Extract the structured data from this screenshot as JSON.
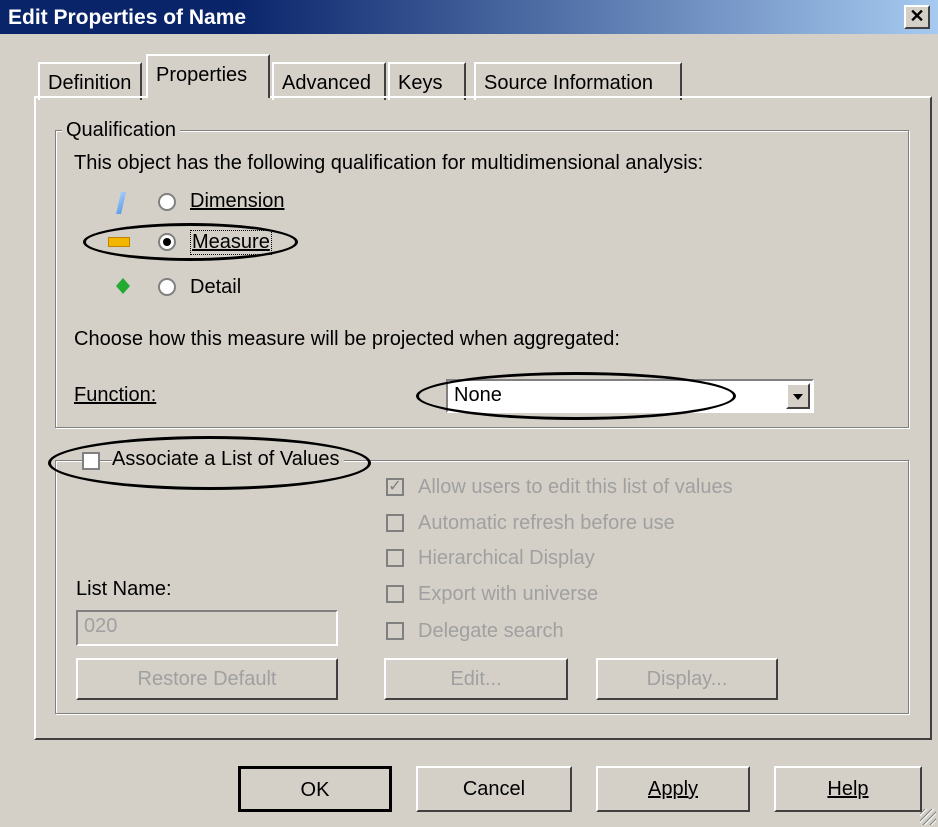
{
  "window": {
    "title": "Edit Properties of Name",
    "close_label": "✕"
  },
  "tabs": [
    {
      "label": "Definition"
    },
    {
      "label": "Properties"
    },
    {
      "label": "Advanced"
    },
    {
      "label": "Keys"
    },
    {
      "label": "Source Information"
    }
  ],
  "qualification": {
    "legend": "Qualification",
    "description": "This object has the following qualification for multidimensional analysis:",
    "options": [
      {
        "label": "Dimension",
        "selected": false,
        "icon": "dimension-icon"
      },
      {
        "label": "Measure",
        "selected": true,
        "icon": "measure-icon"
      },
      {
        "label": "Detail",
        "selected": false,
        "icon": "detail-icon"
      }
    ],
    "aggregation_text": "Choose how this measure will be projected when aggregated:",
    "function_label": "Function:",
    "function_value": "None"
  },
  "lov": {
    "associate_label": "Associate a List of Values",
    "associate_checked": false,
    "options": [
      {
        "label": "Allow users to edit this list of values",
        "checked": true
      },
      {
        "label": "Automatic refresh before use",
        "checked": false
      },
      {
        "label": "Hierarchical Display",
        "checked": false
      },
      {
        "label": "Export with universe",
        "checked": false
      },
      {
        "label": "Delegate search",
        "checked": false
      }
    ],
    "list_name_label": "List Name:",
    "list_name_value": "020",
    "restore_default": "Restore Default",
    "edit": "Edit...",
    "display": "Display..."
  },
  "footer": {
    "ok": "OK",
    "cancel": "Cancel",
    "apply": "Apply",
    "help": "Help"
  },
  "colors": {
    "title_bar": "#0a246a",
    "dialog_bg": "#d4d0c8",
    "disabled_text": "#a0a0a0"
  }
}
